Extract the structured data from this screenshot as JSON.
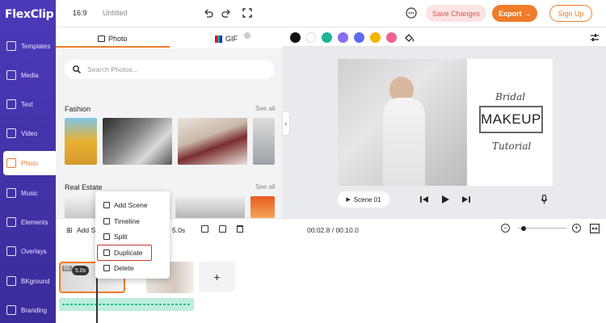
{
  "sidebar": {
    "logo": "FlexClip",
    "items": [
      {
        "label": "Templates",
        "icon": "templates-icon"
      },
      {
        "label": "Media",
        "icon": "media-icon"
      },
      {
        "label": "Text",
        "icon": "text-icon"
      },
      {
        "label": "Video",
        "icon": "video-icon"
      },
      {
        "label": "Photo",
        "icon": "photo-icon",
        "active": true
      },
      {
        "label": "Music",
        "icon": "music-icon"
      },
      {
        "label": "Elements",
        "icon": "elements-icon"
      },
      {
        "label": "Overlays",
        "icon": "overlays-icon"
      },
      {
        "label": "BKground",
        "icon": "background-icon"
      },
      {
        "label": "Branding",
        "icon": "branding-icon"
      }
    ]
  },
  "topbar": {
    "ratio": "16:9",
    "title": "Untitled",
    "save_label": "Save Changes",
    "export_label": "Export →",
    "signup_label": "Sign Up"
  },
  "panel": {
    "tabs": [
      {
        "label": "Photo",
        "active": true
      },
      {
        "label": "GIF"
      }
    ],
    "search_placeholder": "Search Photos...",
    "sections": [
      {
        "title": "Fashion",
        "see_all": "See all"
      },
      {
        "title": "Real Estate",
        "see_all": "See all"
      }
    ]
  },
  "colors": {
    "accent": "#f07c2a",
    "sidebar": "#3c2fa0",
    "swatches": [
      "#111111",
      "#ffffff",
      "#1bb39a",
      "#8a6cf0",
      "#5b6cf0",
      "#f5b400",
      "#f06292"
    ]
  },
  "preview": {
    "text_top": "Bridal",
    "text_main": "MAKEUP",
    "text_bottom": "Tutorial",
    "scene_label": "Scene 01"
  },
  "timeline": {
    "add_scene": "Add Sc",
    "duration": "5.0s",
    "time": "00:02.8 / 00:10.0",
    "clip_duration": "5.0s",
    "clip_index": "01"
  },
  "context_menu": {
    "items": [
      "Add Scene",
      "Timeline",
      "Split",
      "Duplicate",
      "Delete"
    ]
  }
}
